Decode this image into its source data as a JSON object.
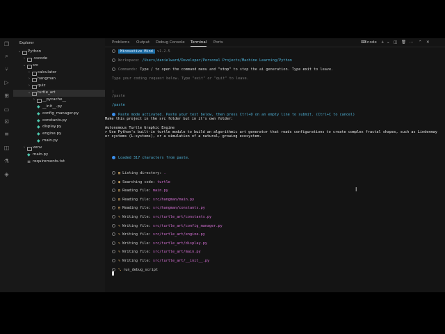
{
  "sidebar": {
    "title": "Explorer",
    "tree": [
      {
        "label": "Python",
        "depth": 0,
        "type": "folder",
        "open": true
      },
      {
        "label": ".vscode",
        "depth": 1,
        "type": "folder",
        "open": false
      },
      {
        "label": "src",
        "depth": 1,
        "type": "folder",
        "open": true
      },
      {
        "label": "calculator",
        "depth": 2,
        "type": "folder",
        "open": false
      },
      {
        "label": "hangman",
        "depth": 2,
        "type": "folder",
        "open": false
      },
      {
        "label": "quiz",
        "depth": 2,
        "type": "folder",
        "open": false
      },
      {
        "label": "turtle_art",
        "depth": 2,
        "type": "folder",
        "open": true,
        "selected": true
      },
      {
        "label": "__pycache__",
        "depth": 3,
        "type": "folder",
        "open": false
      },
      {
        "label": "__init__.py",
        "depth": 3,
        "type": "py"
      },
      {
        "label": "config_manager.py",
        "depth": 3,
        "type": "py"
      },
      {
        "label": "constants.py",
        "depth": 3,
        "type": "py"
      },
      {
        "label": "display.py",
        "depth": 3,
        "type": "py"
      },
      {
        "label": "engine.py",
        "depth": 3,
        "type": "py"
      },
      {
        "label": "main.py",
        "depth": 3,
        "type": "py"
      },
      {
        "label": "venv",
        "depth": 1,
        "type": "folder",
        "open": false
      },
      {
        "label": "main.py",
        "depth": 1,
        "type": "py"
      },
      {
        "label": "requirements.txt",
        "depth": 1,
        "type": "txt"
      }
    ]
  },
  "panel": {
    "tabs": [
      "Problems",
      "Output",
      "Debug Console",
      "Terminal",
      "Ports"
    ],
    "active_tab": "Terminal",
    "terminal_name": "node"
  },
  "terminal": {
    "app_badge": "Minovative Mind",
    "version": "v1.2.5",
    "workspace_label": "Workspace:",
    "workspace_path": "/Users/danielward/Developer/Personal Projects/Machine Learning/Python",
    "commands_label": "Commands:",
    "commands_text_1": "Type / to open the command menu and ",
    "commands_stop": "\"stop\"",
    "commands_text_2": " to stop the ai generation. Type ",
    "commands_exit": "exit",
    "commands_text_3": " to leave.",
    "prompt_placeholder": "Type your coding request below. Type \"exit\" or \"quit\" to leave.",
    "paren": ")",
    "paste_cmd_1": "/paste",
    "paste_cmd_2": "/paste",
    "paste_activated": "Paste mode activated. Paste your text below, then press Ctrl+D on an empty line to submit. (Ctrl+C to cancel)",
    "pasted_1": "Make this project in the src folder but in it's own folder:",
    "pasted_2": "Autonomous Turtle Graphic Engine",
    "pasted_3": "> Use Python's built-in turtle module to build an algorithmic art generator that reads configurations to create complex fractal shapes, such as Lindenmay",
    "pasted_4": "er systems (L-systems), or a simulation of a natural, growing ecosystem.",
    "loaded": "Loaded 317 characters from paste.",
    "actions": [
      {
        "icon": "▦",
        "label": "Listing directory:",
        "arg": "."
      },
      {
        "icon": "●",
        "label": "Searching code:",
        "arg": "turtle"
      },
      {
        "icon": "▤",
        "label": "Reading file:",
        "arg": "main.py"
      },
      {
        "icon": "▤",
        "label": "Reading file:",
        "arg": "src/hangman/main.py"
      },
      {
        "icon": "▤",
        "label": "Reading file:",
        "arg": "src/hangman/constants.py"
      },
      {
        "icon": "✎",
        "label": "Writing file:",
        "arg": "src/turtle_art/constants.py"
      },
      {
        "icon": "✎",
        "label": "Writing file:",
        "arg": "src/turtle_art/config_manager.py"
      },
      {
        "icon": "✎",
        "label": "Writing file:",
        "arg": "src/turtle_art/engine.py"
      },
      {
        "icon": "✎",
        "label": "Writing file:",
        "arg": "src/turtle_art/display.py"
      },
      {
        "icon": "✎",
        "label": "Writing file:",
        "arg": "src/turtle_art/main.py"
      },
      {
        "icon": "✎",
        "label": "Writing file:",
        "arg": "src/turtle_art/__init__.py"
      },
      {
        "icon": "⤡",
        "label": "run_debug_script",
        "arg": ""
      }
    ]
  },
  "colors": {
    "accent": "#3b8eea",
    "badge": "#1e6fa8",
    "path": "#d670d6",
    "link": "#4fb3d9"
  }
}
